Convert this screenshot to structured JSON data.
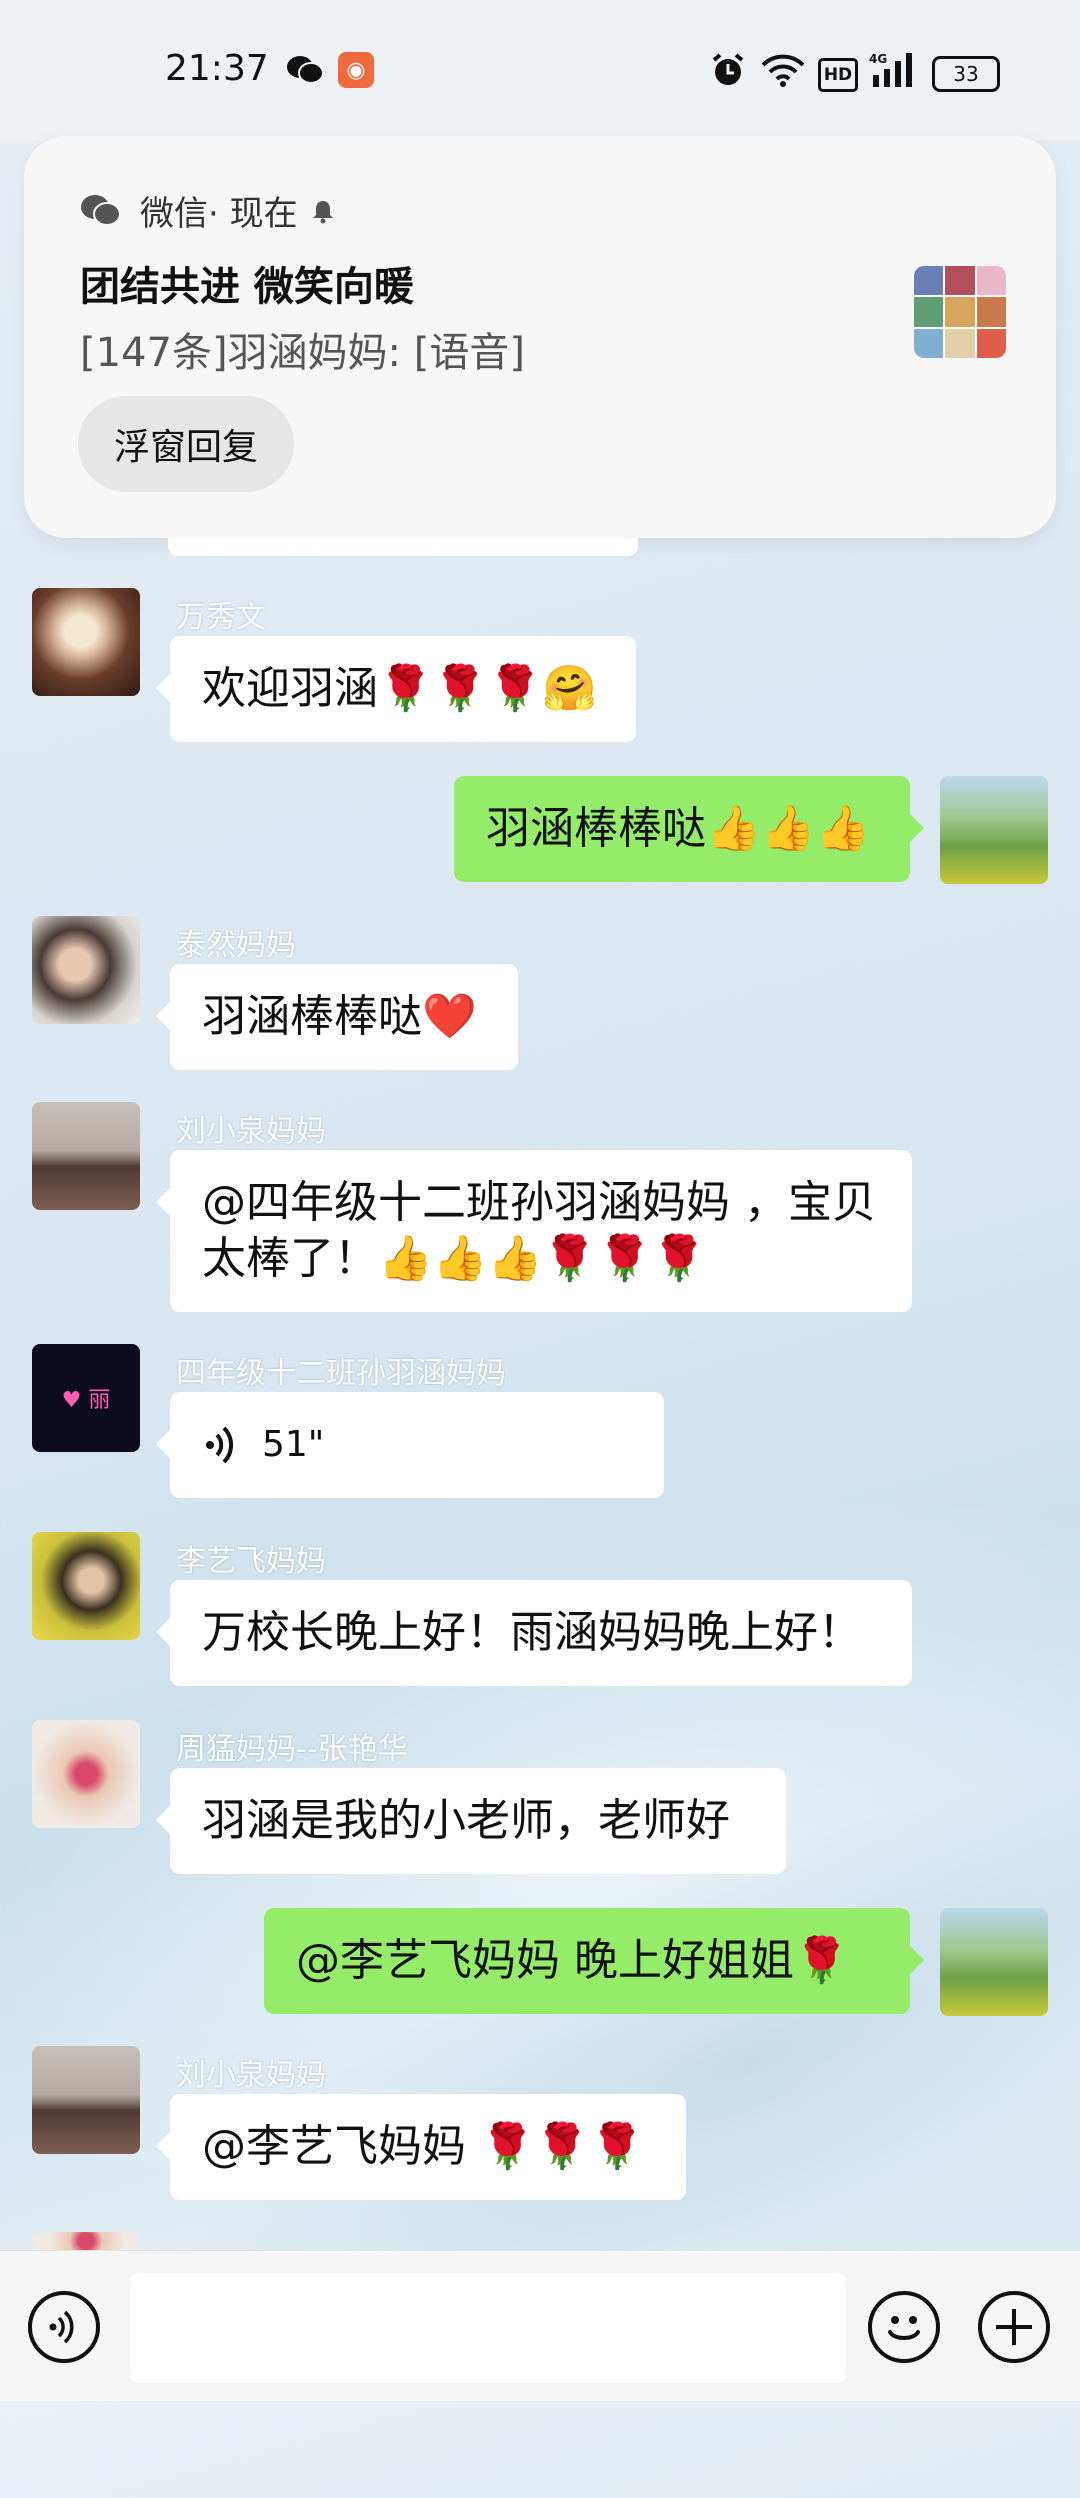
{
  "status_bar": {
    "time": "21:37",
    "battery": "33",
    "network": "4G",
    "hd": "HD"
  },
  "notification": {
    "app_name": "微信",
    "time_label": " · 现在",
    "title": "团结共进  微笑向暖",
    "body": "[147条]羽涵妈妈: [语音]",
    "reply_button": "浮窗回复"
  },
  "messages": [
    {
      "sender": "万秀文",
      "side": "left",
      "text": "欢迎羽涵🌹🌹🌹🤗"
    },
    {
      "sender": "",
      "side": "right",
      "text": "羽涵棒棒哒👍👍👍"
    },
    {
      "sender": "泰然妈妈",
      "side": "left",
      "text": "羽涵棒棒哒❤️"
    },
    {
      "sender": "刘小泉妈妈",
      "side": "left",
      "text": "@四年级十二班孙羽涵妈妈 ，宝贝太棒了！👍👍👍🌹🌹🌹"
    },
    {
      "sender": "四年级十二班孙羽涵妈妈",
      "side": "left",
      "text": "51\"",
      "type": "voice"
    },
    {
      "sender": "李艺飞妈妈",
      "side": "left",
      "text": "万校长晚上好！雨涵妈妈晚上好！"
    },
    {
      "sender": "周猛妈妈--张艳华",
      "side": "left",
      "text": "羽涵是我的小老师，老师好"
    },
    {
      "sender": "",
      "side": "right",
      "text": "@李艺飞妈妈  晚上好姐姐🌹"
    },
    {
      "sender": "刘小泉妈妈",
      "side": "left",
      "text": "@李艺飞妈妈 🌹🌹🌹"
    }
  ],
  "avatar_text": {
    "rose_sign": "♥ 丽"
  },
  "colors": {
    "my_bubble": "#95ec69",
    "other_bubble": "#ffffff",
    "input_bar": "#f6f6f6"
  },
  "icons": [
    "wechat-icon",
    "alarm-icon",
    "wifi-icon",
    "signal-icon",
    "battery-icon",
    "bell-icon",
    "voice-wave-icon",
    "emoji-icon",
    "plus-icon"
  ]
}
